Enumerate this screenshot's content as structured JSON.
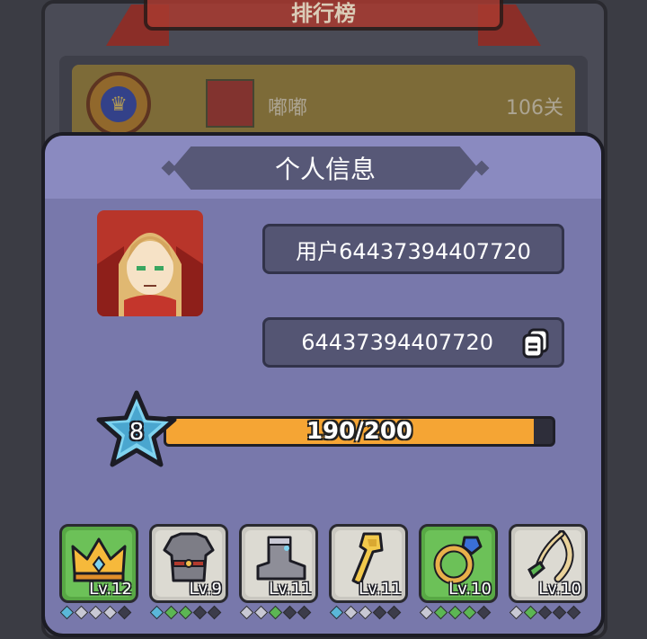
{
  "background": {
    "leaderboard_title": "排行榜",
    "top_entry": {
      "name": "嘟嘟",
      "level": "106关"
    }
  },
  "dialog": {
    "title": "个人信息",
    "username": "用户64437394407720",
    "user_id": "64437394407720",
    "copy_icon": "copy-icon",
    "player_level": "8",
    "xp": {
      "current": 190,
      "max": 200,
      "text": "190/200"
    }
  },
  "equipment": [
    {
      "slot": "crown",
      "level_text": "Lv.12",
      "frame": "green",
      "gems": [
        "blue",
        "empty",
        "empty",
        "empty",
        "dark"
      ]
    },
    {
      "slot": "armor",
      "level_text": "Lv.9",
      "frame": "gray",
      "gems": [
        "blue",
        "green",
        "green",
        "dark",
        "dark"
      ]
    },
    {
      "slot": "boots",
      "level_text": "Lv.11",
      "frame": "gray",
      "gems": [
        "empty",
        "empty",
        "green",
        "dark",
        "dark"
      ]
    },
    {
      "slot": "staff",
      "level_text": "Lv.11",
      "frame": "gray",
      "gems": [
        "blue",
        "empty",
        "empty",
        "dark",
        "dark"
      ]
    },
    {
      "slot": "ring",
      "level_text": "Lv.10",
      "frame": "green",
      "gems": [
        "empty",
        "green",
        "green",
        "green",
        "dark"
      ]
    },
    {
      "slot": "whip",
      "level_text": "Lv.10",
      "frame": "gray",
      "gems": [
        "empty",
        "green",
        "dark",
        "dark",
        "dark"
      ]
    }
  ],
  "colors": {
    "xp_fill": "#f5a534",
    "dialog_bg": "#7878ab",
    "star": "#5ab7d9"
  }
}
